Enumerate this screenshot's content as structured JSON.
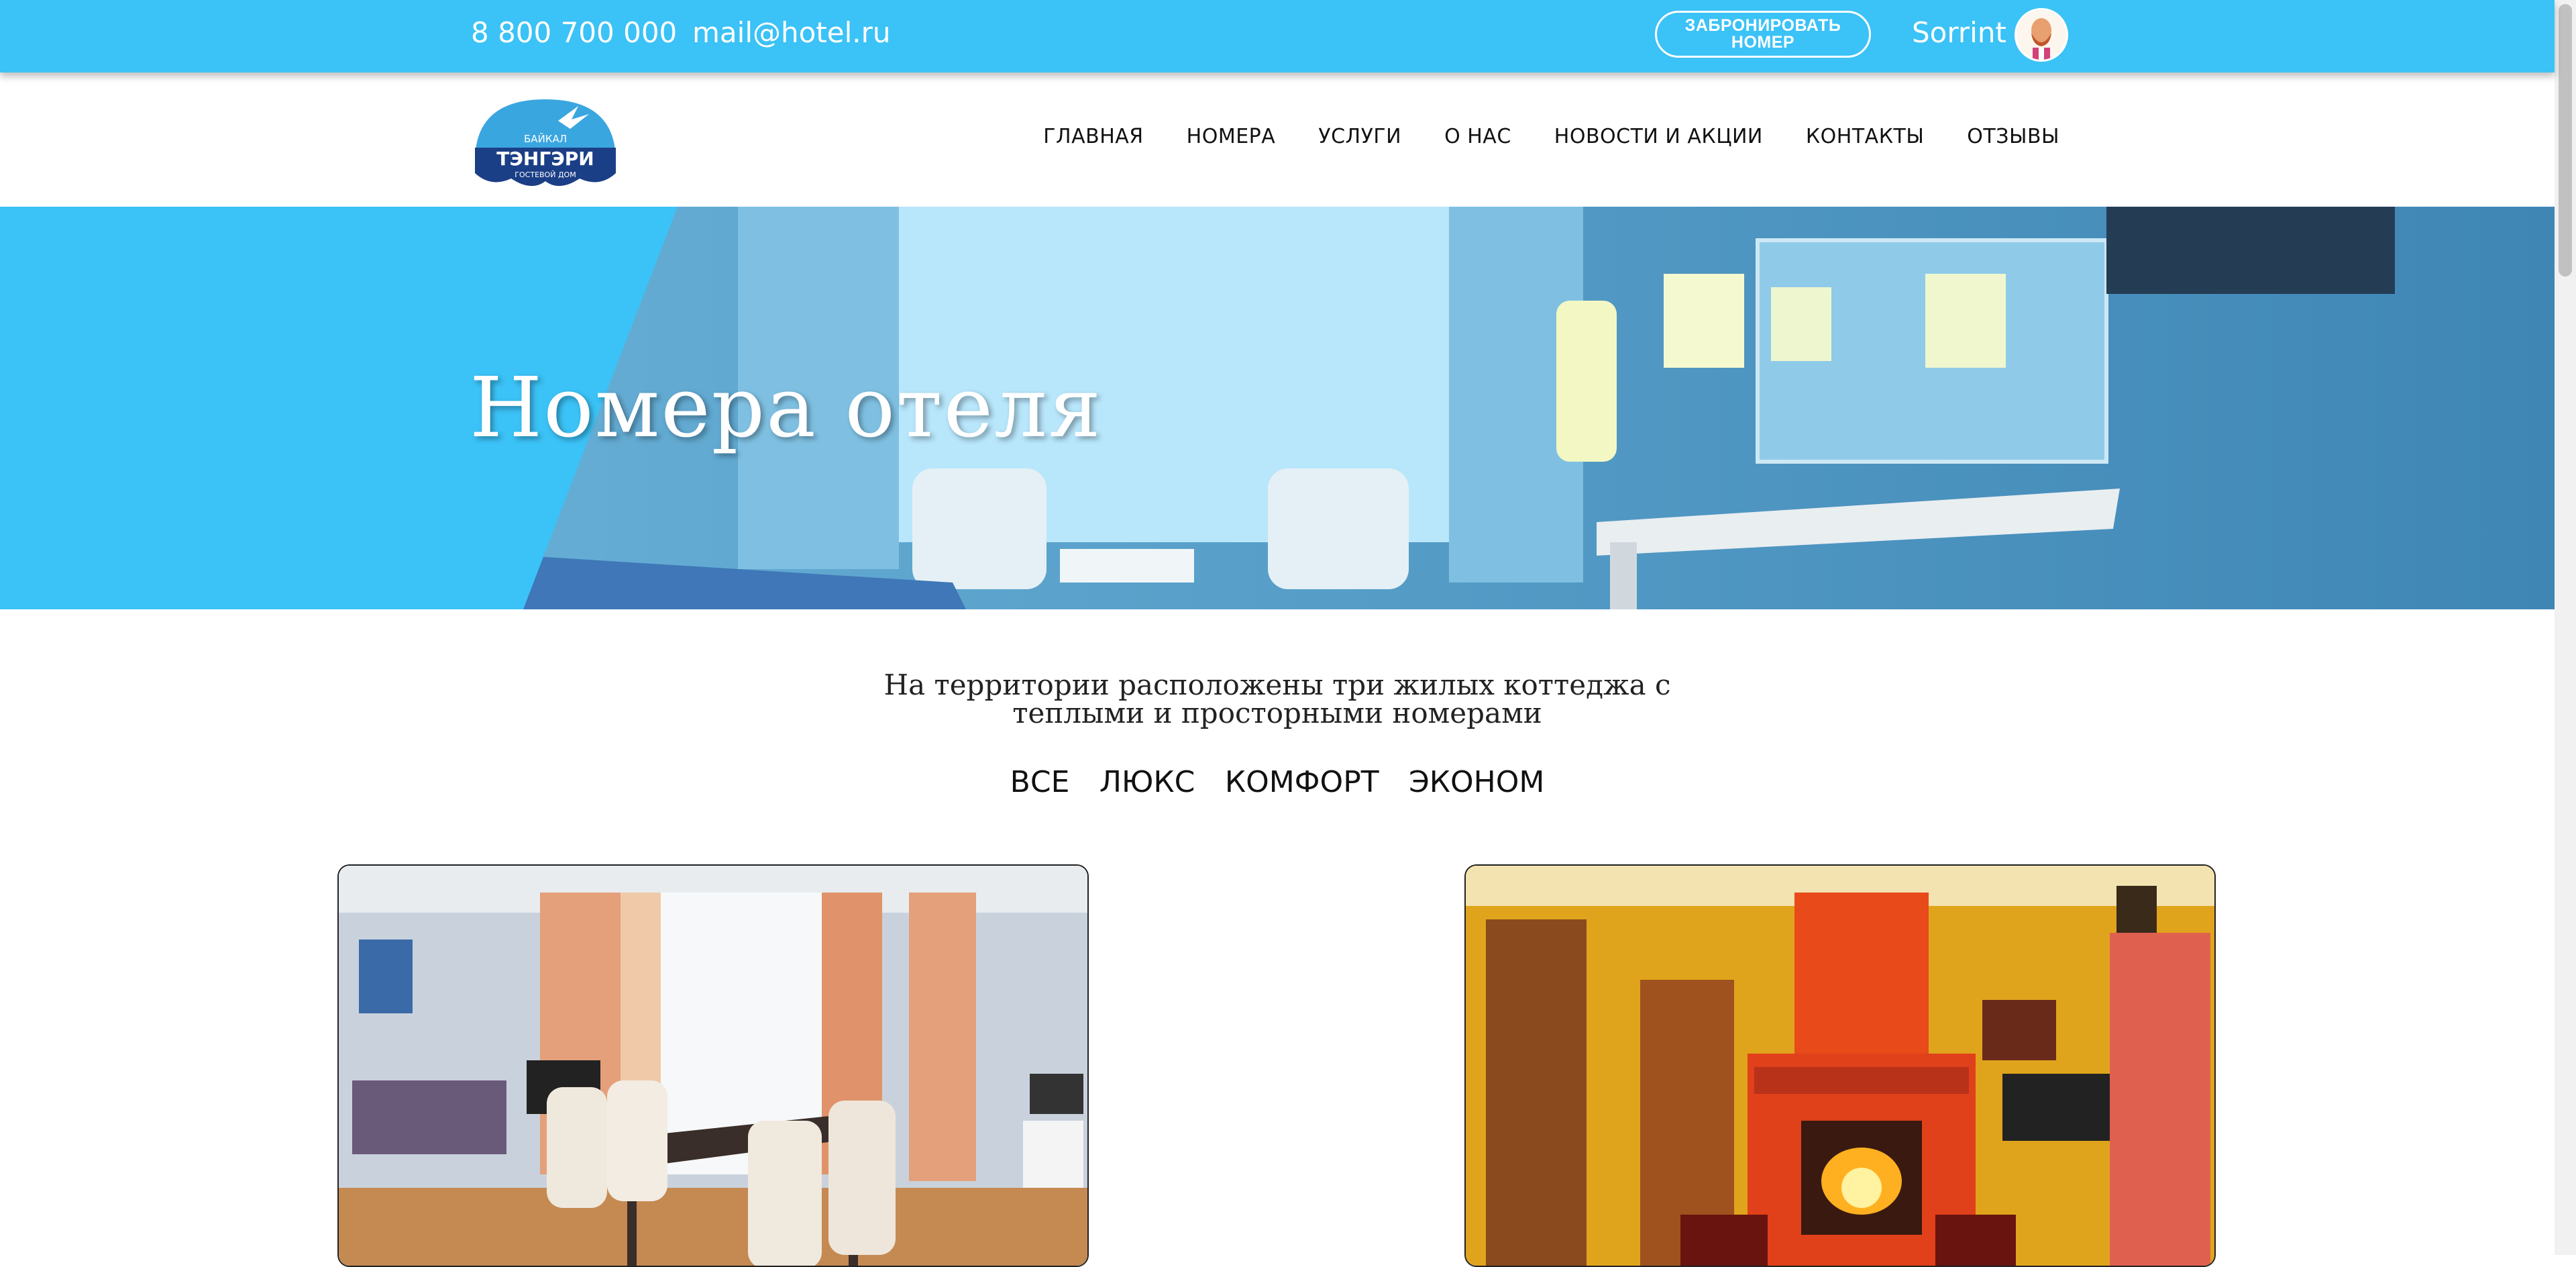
{
  "topbar": {
    "phone": "8 800 700 000",
    "email": "mail@hotel.ru",
    "book_button": "ЗАБРОНИРОВАТЬ НОМЕР",
    "username": "Sorrint"
  },
  "logo": {
    "line1": "БАЙКАЛ",
    "line2": "ТЭНГЭРИ",
    "line3": "ГОСТЕВОЙ ДОМ"
  },
  "nav": {
    "items": [
      "ГЛАВНАЯ",
      "НОМЕРА",
      "УСЛУГИ",
      "О НАС",
      "НОВОСТИ И АКЦИИ",
      "КОНТАКТЫ",
      "ОТЗЫВЫ"
    ]
  },
  "hero": {
    "title": "Номера отеля"
  },
  "intro": {
    "text": "На территории расположены три жилых коттеджа с теплыми и просторными номерами"
  },
  "filters": [
    "ВСЕ",
    "ЛЮКС",
    "КОМФОРТ",
    "ЭКОНОМ"
  ],
  "colors": {
    "accent": "#3bc2f6",
    "text": "#111111"
  }
}
